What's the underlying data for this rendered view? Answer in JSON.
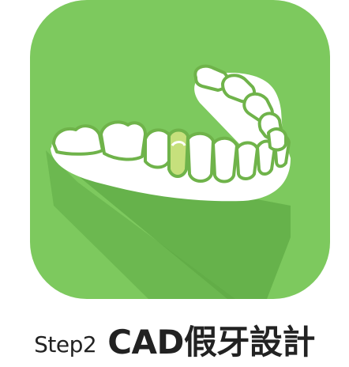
{
  "caption": {
    "step": "Step2",
    "title": "CAD假牙設計"
  },
  "colors": {
    "icon_background": "#7DC95E",
    "icon_shadow": "#5FA946",
    "gum_tooth_fill": "#FFFFFF",
    "tooth_outline": "#6FB34A",
    "highlight_tooth": "#C6E07C",
    "text": "#222222"
  },
  "icon": {
    "name": "dental-cad-crown-icon"
  }
}
